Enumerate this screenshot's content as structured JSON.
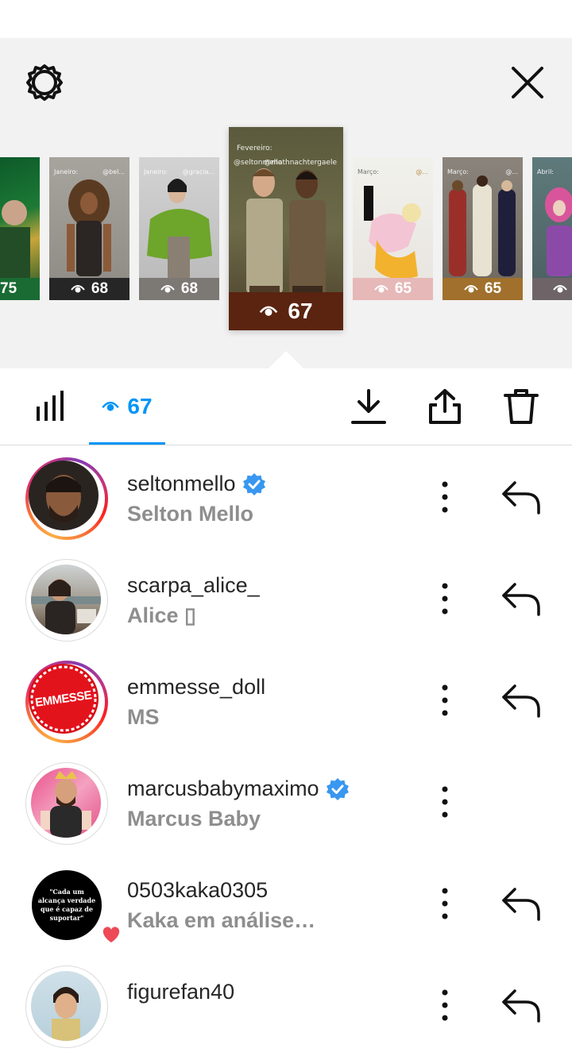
{
  "stories": [
    {
      "count": "75"
    },
    {
      "count": "68",
      "caption_left": "Janeiro:",
      "caption_right": "@bel..."
    },
    {
      "count": "68",
      "caption_left": "Janeiro:",
      "caption_right": "@gracia..."
    },
    {
      "count": "67",
      "caption_top": "Fevereiro:",
      "caption_left": "@seltonmello",
      "caption_right": "@mathnachtergaele"
    },
    {
      "count": "65",
      "caption_left": "Março:",
      "caption_right": "@..."
    },
    {
      "count": "65",
      "caption_left": "Março:",
      "caption_right": "@..."
    },
    {
      "count": "",
      "caption_left": "Abril:"
    }
  ],
  "toolbar": {
    "views_count": "67",
    "icons": [
      "bar-chart-icon",
      "eye-icon",
      "download-icon",
      "share-icon",
      "trash-icon"
    ]
  },
  "top_icons": [
    "gear-icon",
    "close-icon"
  ],
  "viewers": [
    {
      "username": "seltonmello",
      "name": "Selton Mello",
      "verified": true,
      "story_ring": true,
      "reply": true
    },
    {
      "username": "scarpa_alice_",
      "name": "Alice ▯",
      "verified": false,
      "story_ring": false,
      "reply": true
    },
    {
      "username": "emmesse_doll",
      "name": "MS",
      "verified": false,
      "story_ring": true,
      "reply": true,
      "avatar_text": "EMMESSE"
    },
    {
      "username": "marcusbabymaximo",
      "name": "Marcus Baby",
      "verified": true,
      "story_ring": false,
      "reply": false
    },
    {
      "username": "0503kaka0305",
      "name": "Kaka em análise…",
      "verified": false,
      "story_ring": false,
      "reply": true,
      "avatar_text": "\"Cada um alcança verdade que é capaz de suportar\""
    },
    {
      "username": "figurefan40",
      "name": "",
      "verified": false,
      "story_ring": false,
      "reply": true
    }
  ],
  "colors": {
    "accent": "#0095f6",
    "verified": "#3897f0",
    "heart": "#ed4956",
    "secondary_text": "#8e8e8e"
  }
}
